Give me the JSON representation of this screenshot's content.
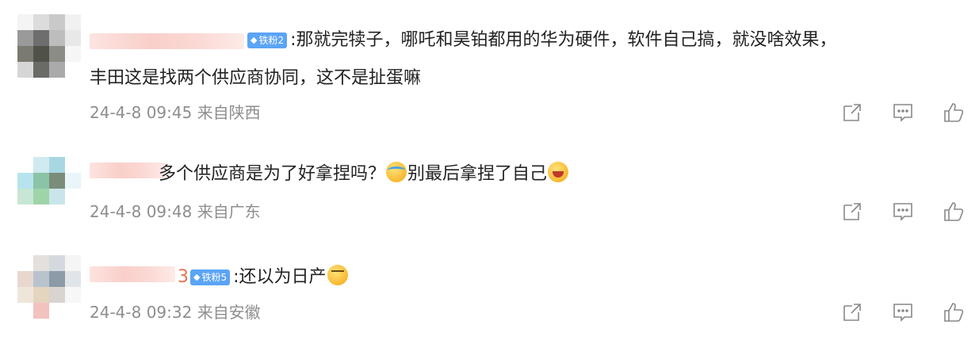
{
  "comments": [
    {
      "name_suffix": "",
      "badge": "铁粉2",
      "text_line1": ":那就完犊子，哪吒和昊铂都用的华为硬件，软件自己搞，就没啥效果，",
      "text_line2": "丰田这是找两个供应商协同，这不是扯蛋嘛",
      "time": "24-4-8 09:45",
      "location": "来自陕西"
    },
    {
      "name_suffix": "",
      "badge": "",
      "text_a": "多个供应商是为了好拿捏吗？",
      "emoji_a": "cry-laugh-emoji",
      "text_b": "别最后拿捏了自己",
      "emoji_b": "laugh-emoji",
      "time": "24-4-8 09:48",
      "location": "来自广东"
    },
    {
      "name_suffix": "3",
      "badge": "铁粉5",
      "text_a": ":还以为日产",
      "emoji_a": "shy-emoji",
      "time": "24-4-8 09:32",
      "location": "来自安徽"
    }
  ],
  "action_icons": [
    "share-icon",
    "comment-icon",
    "like-icon"
  ],
  "colors": {
    "meta": "#8e8e8e",
    "badge": "#5ba4f6",
    "name": "#eb7350"
  }
}
